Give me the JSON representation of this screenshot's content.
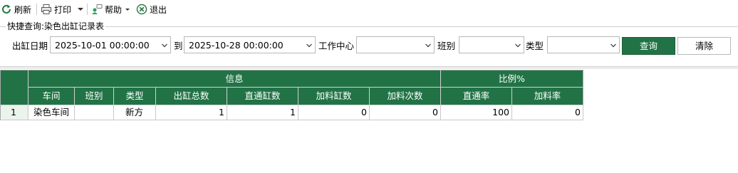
{
  "toolbar": {
    "refresh_label": "刷新",
    "print_label": "打印",
    "help_label": "帮助",
    "exit_label": "退出"
  },
  "query": {
    "title": "快捷查询:染色出缸记录表",
    "date_label": "出缸日期",
    "date_from": "2025-10-01 00:00:00",
    "to_label": "到",
    "date_to": "2025-10-28 00:00:00",
    "workcenter_label": "工作中心",
    "workcenter_value": "",
    "shift_label": "班别",
    "shift_value": "",
    "type_label": "类型",
    "type_value": "",
    "search_button": "查询",
    "clear_button": "清除"
  },
  "grid": {
    "group_headers": [
      "信息",
      "比例%"
    ],
    "columns": [
      "车间",
      "班别",
      "类型",
      "出缸总数",
      "直通缸数",
      "加料缸数",
      "加料次数",
      "直通率",
      "加料率"
    ],
    "rows": [
      {
        "row_no": "1",
        "cells": [
          "染色车间",
          "",
          "新方",
          "1",
          "1",
          "0",
          "0",
          "100",
          "0"
        ]
      }
    ]
  },
  "colors": {
    "accent": "#217346",
    "border": "#a9a9a9"
  }
}
